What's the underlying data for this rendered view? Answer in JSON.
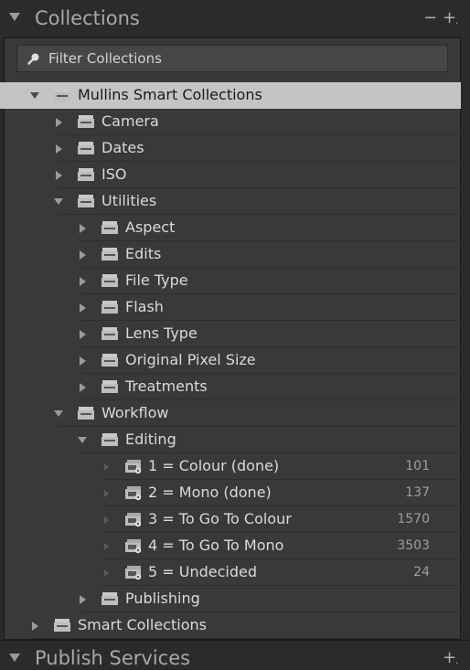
{
  "panel": {
    "title": "Collections",
    "minus_label": "−",
    "plus_label": "+"
  },
  "filter": {
    "placeholder": "Filter Collections"
  },
  "tree": [
    {
      "label": "Mullins Smart Collections",
      "level": 1,
      "twisty": "down",
      "type": "set",
      "selected": true
    },
    {
      "label": "Camera",
      "level": 2,
      "twisty": "right",
      "type": "set"
    },
    {
      "label": "Dates",
      "level": 2,
      "twisty": "right",
      "type": "set"
    },
    {
      "label": "ISO",
      "level": 2,
      "twisty": "right",
      "type": "set"
    },
    {
      "label": "Utilities",
      "level": 2,
      "twisty": "down",
      "type": "set"
    },
    {
      "label": "Aspect",
      "level": 3,
      "twisty": "right",
      "type": "set"
    },
    {
      "label": "Edits",
      "level": 3,
      "twisty": "right",
      "type": "set"
    },
    {
      "label": "File Type",
      "level": 3,
      "twisty": "right",
      "type": "set"
    },
    {
      "label": "Flash",
      "level": 3,
      "twisty": "right",
      "type": "set"
    },
    {
      "label": "Lens Type",
      "level": 3,
      "twisty": "right",
      "type": "set"
    },
    {
      "label": "Original Pixel Size",
      "level": 3,
      "twisty": "right",
      "type": "set"
    },
    {
      "label": "Treatments",
      "level": 3,
      "twisty": "right",
      "type": "set"
    },
    {
      "label": "Workflow",
      "level": 2,
      "twisty": "down",
      "type": "set"
    },
    {
      "label": "Editing",
      "level": 3,
      "twisty": "down",
      "type": "set"
    },
    {
      "label": "1 = Colour (done)",
      "level": 4,
      "twisty": "dim",
      "type": "smart",
      "count": "101"
    },
    {
      "label": "2 = Mono (done)",
      "level": 4,
      "twisty": "dim",
      "type": "smart",
      "count": "137"
    },
    {
      "label": "3 = To Go To Colour",
      "level": 4,
      "twisty": "dim",
      "type": "smart",
      "count": "1570"
    },
    {
      "label": "4 = To Go To Mono",
      "level": 4,
      "twisty": "dim",
      "type": "smart",
      "count": "3503"
    },
    {
      "label": "5 = Undecided",
      "level": 4,
      "twisty": "dim",
      "type": "smart",
      "count": "24"
    },
    {
      "label": "Publishing",
      "level": 3,
      "twisty": "right",
      "type": "set"
    },
    {
      "label": "Smart Collections",
      "level": 1,
      "twisty": "right",
      "type": "set"
    }
  ],
  "publish": {
    "title": "Publish Services",
    "plus_label": "+"
  }
}
